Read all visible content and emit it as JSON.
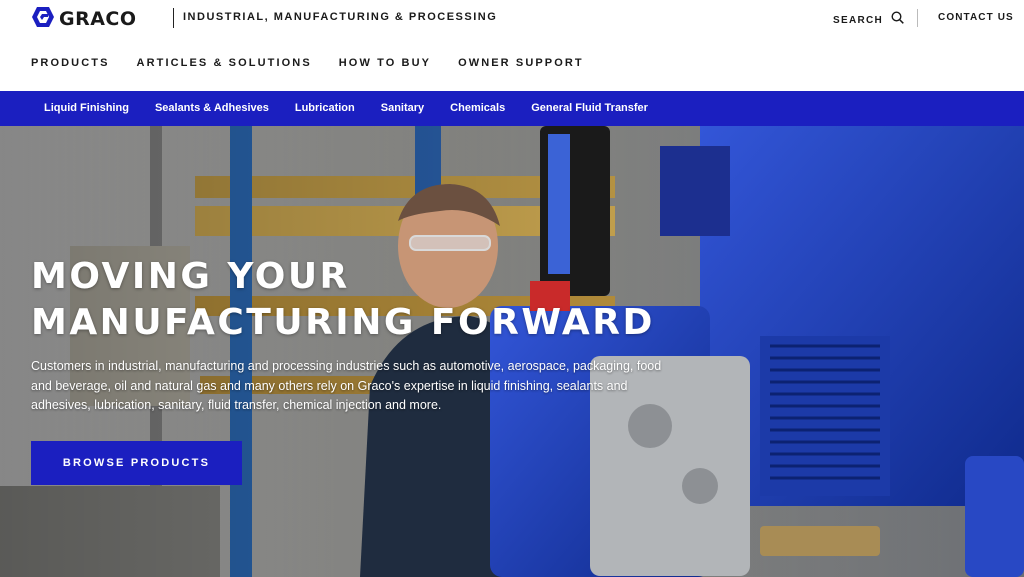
{
  "brand": {
    "logo_text": "GRACO",
    "division": "INDUSTRIAL, MANUFACTURING & PROCESSING"
  },
  "utility": {
    "search_label": "SEARCH",
    "contact_label": "CONTACT US"
  },
  "main_nav": {
    "items": [
      {
        "label": "PRODUCTS"
      },
      {
        "label": "ARTICLES & SOLUTIONS"
      },
      {
        "label": "HOW TO BUY"
      },
      {
        "label": "OWNER SUPPORT"
      }
    ]
  },
  "category_nav": {
    "items": [
      {
        "label": "Liquid Finishing"
      },
      {
        "label": "Sealants & Adhesives"
      },
      {
        "label": "Lubrication"
      },
      {
        "label": "Sanitary"
      },
      {
        "label": "Chemicals"
      },
      {
        "label": "General Fluid Transfer"
      }
    ]
  },
  "hero": {
    "title": "MOVING YOUR MANUFACTURING FORWARD",
    "body": "Customers in industrial, manufacturing and processing industries such as automotive, aerospace, packaging, food and beverage, oil and natural gas and many others rely on Graco's expertise in liquid finishing, sealants and adhesives, lubrication, sanitary, fluid transfer, chemical injection and more.",
    "cta_label": "BROWSE PRODUCTS"
  },
  "colors": {
    "brand_blue": "#1b1fc0",
    "text_dark": "#1a1a1a"
  },
  "icons": {
    "logo": "graco-logo-icon",
    "search": "search-icon"
  }
}
